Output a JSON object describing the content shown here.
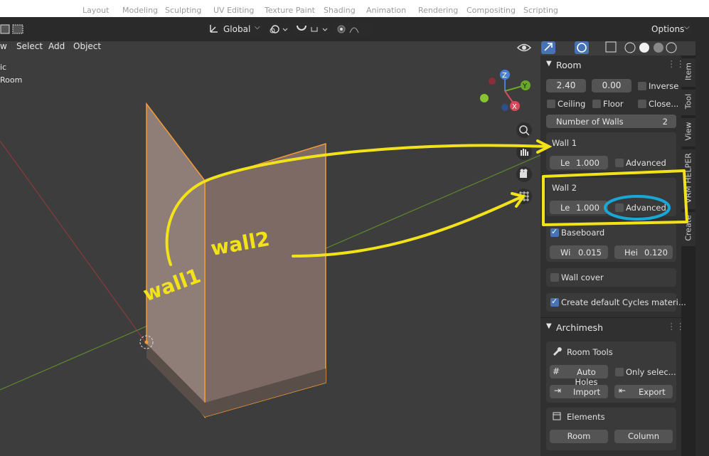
{
  "header": {
    "workspace_tabs": [
      "Layout",
      "Modeling",
      "Sculpting",
      "UV Editing",
      "Texture Paint",
      "Shading",
      "Animation",
      "Rendering",
      "Compositing",
      "Scripting"
    ],
    "orientation": "Global",
    "options_label": "Options"
  },
  "menu": {
    "view_partial": "w",
    "select": "Select",
    "add": "Add",
    "object": "Object"
  },
  "overlay_text": {
    "line1": "ic",
    "line2": "Room"
  },
  "room_panel": {
    "title": "Room",
    "height_value": "2.40",
    "offset_value": "0.00",
    "inverse_label": "Inverse",
    "ceiling_label": "Ceiling",
    "floor_label": "Floor",
    "close_label": "Close...",
    "num_walls_label": "Number of Walls",
    "num_walls_value": "2",
    "wall1": {
      "title": "Wall 1",
      "len_label": "Le",
      "len_value": "1.000",
      "advanced_label": "Advanced"
    },
    "wall2": {
      "title": "Wall 2",
      "len_label": "Le",
      "len_value": "1.000",
      "advanced_label": "Advanced"
    },
    "baseboard_label": "Baseboard",
    "baseboard_checked": true,
    "bb_width_label": "Wi",
    "bb_width_value": "0.015",
    "bb_height_label": "Hei",
    "bb_height_value": "0.120",
    "wall_cover_label": "Wall cover",
    "cycles_label": "Create default Cycles materi...",
    "cycles_checked": true
  },
  "archimesh_panel": {
    "title": "Archimesh",
    "room_tools_label": "Room Tools",
    "auto_holes_label": "Auto Holes",
    "only_selected_label": "Only selec...",
    "import_label": "Import",
    "export_label": "Export",
    "elements_label": "Elements",
    "room_button": "Room",
    "column_button": "Column"
  },
  "side_tabs": [
    "Item",
    "Tool",
    "View",
    "VRM HELPER",
    "Create"
  ],
  "gizmo": {
    "z": "Z",
    "y": "Y",
    "x": "X"
  },
  "annotations": {
    "handwritten_wall1": "wall1",
    "handwritten_wall2": "wall2",
    "ink_color": "#f2e21a",
    "circle_color": "#1aa6d6"
  },
  "colors": {
    "selection_orange": "#f29c38",
    "panel_bg": "#303030",
    "checkbox_blue": "#4772b3"
  }
}
